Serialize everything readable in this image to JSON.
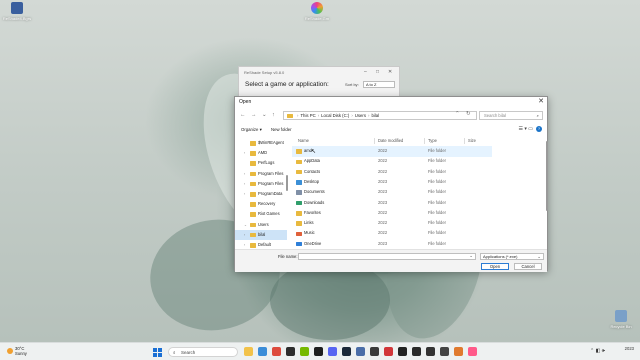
{
  "desktop": {
    "icons": [
      {
        "label": "ReShade4.Bgrs",
        "color": "#3a5f9e"
      },
      {
        "label": "ReShade.Gm",
        "color": "#f04080"
      },
      {
        "label": "Recycle Bin",
        "color": "#7aa0c8"
      }
    ]
  },
  "reshade_window": {
    "title": "ReShade Setup v5.8.0",
    "heading": "Select a game or application:",
    "sort_label": "Sort by:",
    "sort_value": "A to Z",
    "controls": [
      "–",
      "□",
      "✕"
    ]
  },
  "dialog": {
    "title": "Open",
    "close": "✕",
    "nav": {
      "back": "←",
      "forward": "→",
      "dropdown": "⌄",
      "up": "↑",
      "history": "⌃",
      "refresh": "↻"
    },
    "breadcrumb": [
      "This PC",
      "Local Disk (C:)",
      "Users",
      "bilal"
    ],
    "search_placeholder": "Search bilal",
    "toolbar": {
      "organize": "Organize ▾",
      "new_folder": "New folder",
      "view_icons": "☰ ▾  ▭",
      "help": "?"
    },
    "nav_pane": [
      {
        "label": "$WinREAgent",
        "arrow": "",
        "color": "#e8b93e"
      },
      {
        "label": "AMD",
        "arrow": "›",
        "color": "#e8b93e"
      },
      {
        "label": "PerfLogs",
        "arrow": "",
        "color": "#e8b93e"
      },
      {
        "label": "Program Files",
        "arrow": "›",
        "color": "#e8b93e"
      },
      {
        "label": "Program Files",
        "arrow": "›",
        "color": "#e8b93e"
      },
      {
        "label": "ProgramData",
        "arrow": "›",
        "color": "#e8b93e"
      },
      {
        "label": "Recovery",
        "arrow": "",
        "color": "#e8b93e"
      },
      {
        "label": "Riot Games",
        "arrow": "",
        "color": "#e8b93e"
      },
      {
        "label": "Users",
        "arrow": "⌄",
        "color": "#e8b93e"
      },
      {
        "label": "bilal",
        "arrow": "›",
        "color": "#e8b93e",
        "selected": true
      },
      {
        "label": "Default",
        "arrow": "›",
        "color": "#e8b93e"
      }
    ],
    "columns": {
      "name": "Name",
      "date": "Date modified",
      "type": "Type",
      "size": "Size"
    },
    "files": [
      {
        "name": "amd",
        "date": "2022",
        "type": "File folder",
        "color": "#e8b93e"
      },
      {
        "name": "AppData",
        "date": "2022",
        "type": "File folder",
        "color": "#e8b93e"
      },
      {
        "name": "Contacts",
        "date": "2022",
        "type": "File folder",
        "color": "#e8b93e"
      },
      {
        "name": "Desktop",
        "date": "2023",
        "type": "File folder",
        "color": "#3b8fd6"
      },
      {
        "name": "Documents",
        "date": "2023",
        "type": "File folder",
        "color": "#7f8fa6"
      },
      {
        "name": "Downloads",
        "date": "2023",
        "type": "File folder",
        "color": "#2f9e6b"
      },
      {
        "name": "Favorites",
        "date": "2022",
        "type": "File folder",
        "color": "#e8b93e"
      },
      {
        "name": "Links",
        "date": "2022",
        "type": "File folder",
        "color": "#e8b93e"
      },
      {
        "name": "Music",
        "date": "2022",
        "type": "File folder",
        "color": "#e0603a"
      },
      {
        "name": "OneDrive",
        "date": "2023",
        "type": "File folder",
        "color": "#2e7fd8"
      }
    ],
    "file_name_label": "File name:",
    "file_name_value": "",
    "filter_value": "Applications (*.exe)",
    "open_label": "Open",
    "cancel_label": "Cancel"
  },
  "taskbar": {
    "weather_temp": "30°C",
    "weather_desc": "Sunny",
    "search_label": "Search",
    "apps": [
      {
        "name": "file-explorer-app",
        "color": "#f2c24a"
      },
      {
        "name": "store-app",
        "color": "#3c8dd8"
      },
      {
        "name": "chrome-app",
        "color": "#dd4b3e"
      },
      {
        "name": "terminal-app",
        "color": "#2d2d2d"
      },
      {
        "name": "nvidia-app",
        "color": "#76b900"
      },
      {
        "name": "dark-app",
        "color": "#1e1e1e"
      },
      {
        "name": "discord-app",
        "color": "#5865f2"
      },
      {
        "name": "steam-app",
        "color": "#1b2838"
      },
      {
        "name": "hex-app",
        "color": "#4a6da7"
      },
      {
        "name": "app-gray",
        "color": "#3a3a3a"
      },
      {
        "name": "riot-app",
        "color": "#d13639"
      },
      {
        "name": "app-dark2",
        "color": "#222"
      },
      {
        "name": "app-dark3",
        "color": "#2a2a2a"
      },
      {
        "name": "app-dark4",
        "color": "#333"
      },
      {
        "name": "app-dark5",
        "color": "#444"
      },
      {
        "name": "app-orange",
        "color": "#e07a2f"
      },
      {
        "name": "reshade-app",
        "color": "#ff5a8a"
      }
    ],
    "tray_icons": "⌃ ◧ 🕪",
    "time": "",
    "date": "2023"
  }
}
